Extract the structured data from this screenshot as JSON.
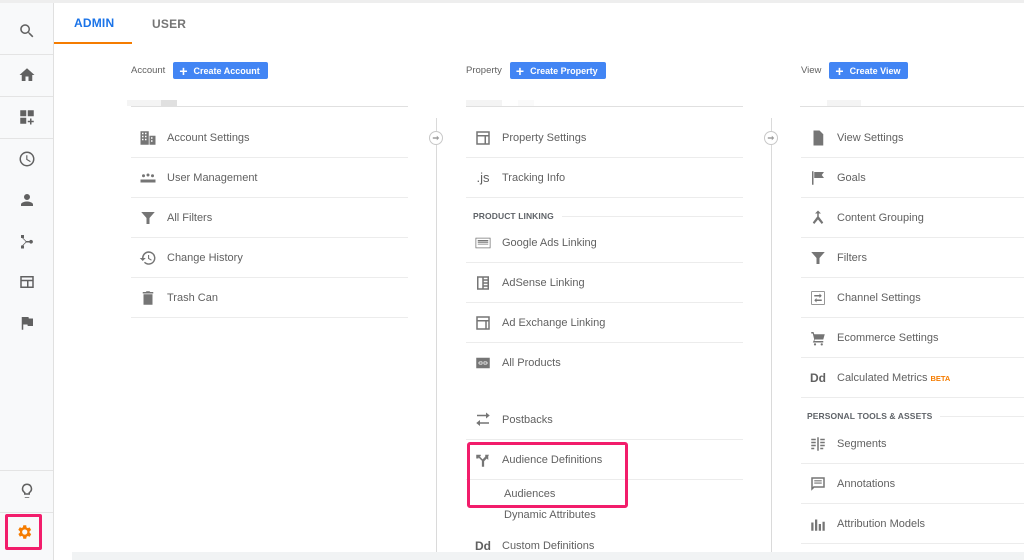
{
  "tabs": [
    {
      "label": "ADMIN",
      "active": true
    },
    {
      "label": "USER",
      "active": false
    }
  ],
  "sidebar": {
    "items": [
      {
        "icon": "search-icon"
      },
      {
        "icon": "home-icon"
      },
      {
        "icon": "customization-icon"
      },
      {
        "icon": "realtime-clock-icon"
      },
      {
        "icon": "audience-person-icon"
      },
      {
        "icon": "acquisition-icon"
      },
      {
        "icon": "behavior-icon"
      },
      {
        "icon": "conversions-flag-icon"
      },
      {
        "icon": "discover-lightbulb-icon"
      },
      {
        "icon": "admin-gear-icon"
      }
    ]
  },
  "account": {
    "label": "Account",
    "create_label": "Create Account",
    "items": [
      {
        "label": "Account Settings",
        "icon": "building-icon"
      },
      {
        "label": "User Management",
        "icon": "people-icon"
      },
      {
        "label": "All Filters",
        "icon": "filter-icon"
      },
      {
        "label": "Change History",
        "icon": "history-icon"
      },
      {
        "label": "Trash Can",
        "icon": "trash-icon"
      }
    ]
  },
  "property": {
    "label": "Property",
    "create_label": "Create Property",
    "items": [
      {
        "label": "Property Settings",
        "icon": "window-icon"
      },
      {
        "label": "Tracking Info",
        "icon": "js-icon",
        "glyph": ".js"
      }
    ],
    "section": "PRODUCT LINKING",
    "linking": [
      {
        "label": "Google Ads Linking",
        "icon": "ads-icon"
      },
      {
        "label": "AdSense Linking",
        "icon": "adsense-icon"
      },
      {
        "label": "Ad Exchange Linking",
        "icon": "adexchange-icon"
      },
      {
        "label": "All Products",
        "icon": "link-icon"
      }
    ],
    "more": [
      {
        "label": "Postbacks",
        "icon": "postbacks-icon"
      },
      {
        "label": "Audience Definitions",
        "icon": "audience-def-icon"
      }
    ],
    "sub": [
      "Audiences",
      "Dynamic Attributes"
    ],
    "custom": {
      "label": "Custom Definitions",
      "glyph": "Dd"
    }
  },
  "view": {
    "label": "View",
    "create_label": "Create View",
    "items": [
      {
        "label": "View Settings",
        "icon": "document-icon"
      },
      {
        "label": "Goals",
        "icon": "flag-icon"
      },
      {
        "label": "Content Grouping",
        "icon": "grouping-icon"
      },
      {
        "label": "Filters",
        "icon": "filter-icon"
      },
      {
        "label": "Channel Settings",
        "icon": "channel-icon"
      },
      {
        "label": "Ecommerce Settings",
        "icon": "cart-icon"
      },
      {
        "label": "Calculated Metrics",
        "icon": "dd-icon",
        "glyph": "Dd",
        "badge": "BETA"
      }
    ],
    "section": "PERSONAL TOOLS & ASSETS",
    "personal": [
      {
        "label": "Segments",
        "icon": "segments-icon"
      },
      {
        "label": "Annotations",
        "icon": "annotations-icon"
      },
      {
        "label": "Attribution Models",
        "icon": "attribution-icon"
      }
    ]
  },
  "colors": {
    "accent": "#1a73e8",
    "tab_underline": "#f57c00",
    "button": "#4285f4",
    "highlight": "#f21d6b",
    "gear": "#f57c00",
    "beta": "#f57c00"
  }
}
